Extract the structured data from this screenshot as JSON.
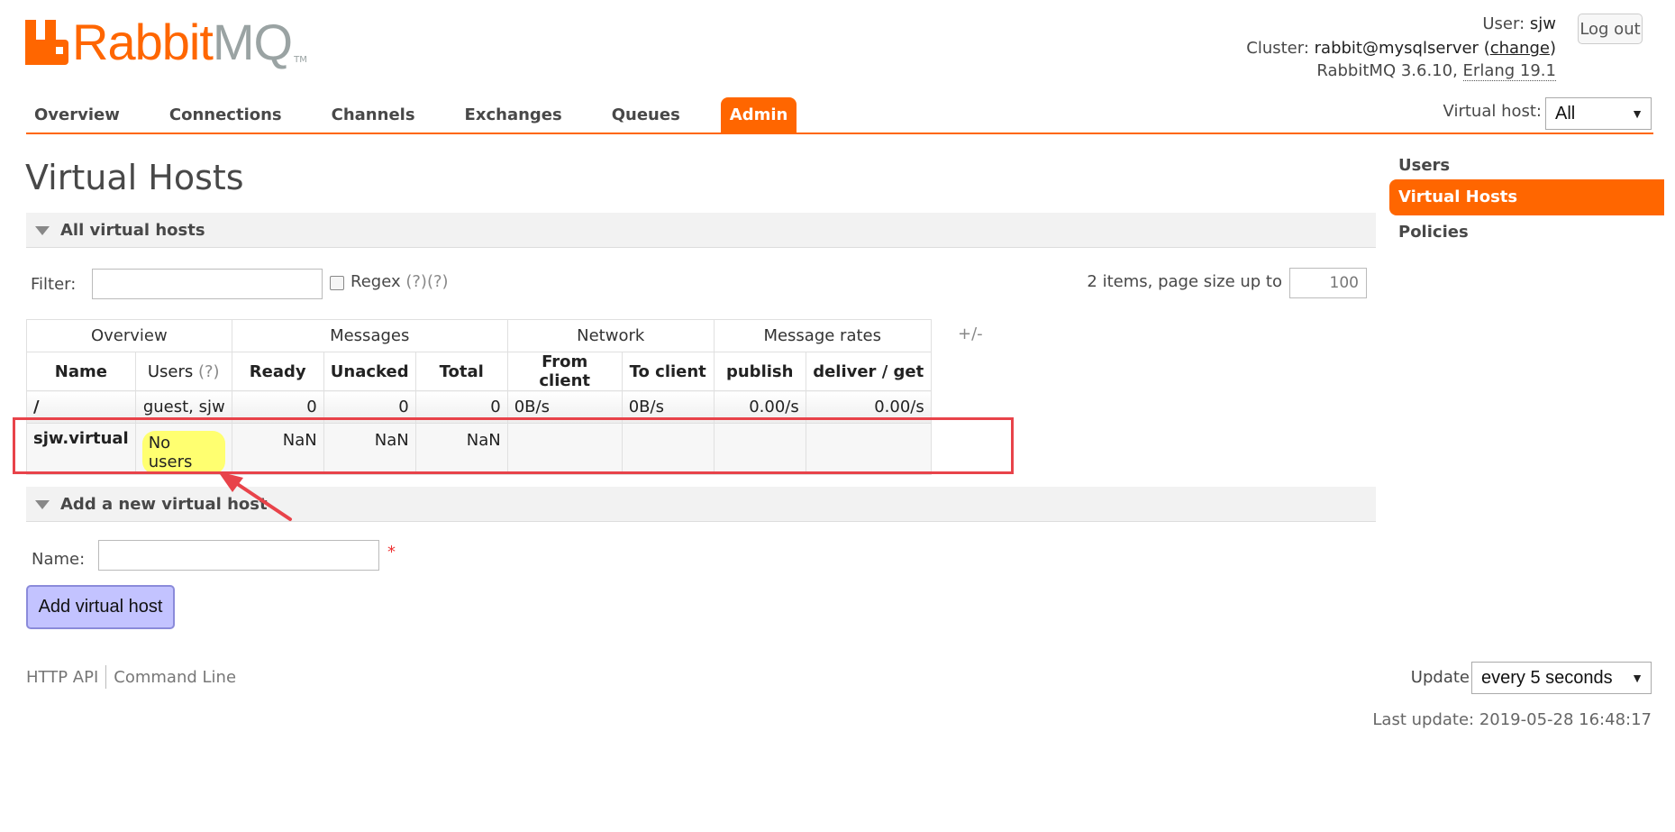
{
  "header": {
    "logo_text_primary": "Rabbit",
    "logo_text_secondary": "MQ",
    "logo_tm": "TM",
    "user_label": "User:",
    "user_value": "sjw",
    "cluster_label": "Cluster:",
    "cluster_value": "rabbit@mysqlserver",
    "cluster_change_link": "change",
    "version_text": "RabbitMQ 3.6.10,",
    "erlang_text": "Erlang 19.1",
    "logout_label": "Log out"
  },
  "nav": {
    "tabs": [
      {
        "label": "Overview"
      },
      {
        "label": "Connections"
      },
      {
        "label": "Channels"
      },
      {
        "label": "Exchanges"
      },
      {
        "label": "Queues"
      },
      {
        "label": "Admin",
        "active": true
      }
    ],
    "virtual_host_label": "Virtual host:",
    "virtual_host_value": "All"
  },
  "page": {
    "title": "Virtual Hosts"
  },
  "sidebar": {
    "items": [
      {
        "label": "Users"
      },
      {
        "label": "Virtual Hosts",
        "active": true
      },
      {
        "label": "Policies"
      }
    ]
  },
  "all_vhosts": {
    "section_title": "All virtual hosts",
    "filter_label": "Filter:",
    "filter_value": "",
    "regex_label": "Regex",
    "regex_help": "(?)(?)",
    "items_text": "2 items, page size up to",
    "page_size": "100",
    "plus_minus": "+/-",
    "group_headers": [
      "Overview",
      "Messages",
      "Network",
      "Message rates"
    ],
    "columns": [
      "Name",
      "Users",
      "Ready",
      "Unacked",
      "Total",
      "From client",
      "To client",
      "publish",
      "deliver / get"
    ],
    "users_help": "(?)",
    "rows": [
      {
        "name": "/",
        "users": "guest, sjw",
        "ready": "0",
        "unacked": "0",
        "total": "0",
        "from_client": "0B/s",
        "to_client": "0B/s",
        "publish": "0.00/s",
        "deliver_get": "0.00/s"
      },
      {
        "name": "sjw.virtual",
        "users": "No users",
        "ready": "NaN",
        "unacked": "NaN",
        "total": "NaN",
        "from_client": "",
        "to_client": "",
        "publish": "",
        "deliver_get": ""
      }
    ]
  },
  "add_vhost": {
    "section_title": "Add a new virtual host",
    "name_label": "Name:",
    "name_value": "",
    "required_mark": "*",
    "button_label": "Add virtual host"
  },
  "footer": {
    "http_api": "HTTP API",
    "command_line": "Command Line",
    "update_label": "Update",
    "update_value": "every 5 seconds",
    "last_update": "Last update: 2019-05-28 16:48:17"
  },
  "colors": {
    "accent": "#ff6600",
    "annotation_red": "#e8434a",
    "no_users_highlight": "#ffff70",
    "button_bg": "#c3c3ff"
  }
}
